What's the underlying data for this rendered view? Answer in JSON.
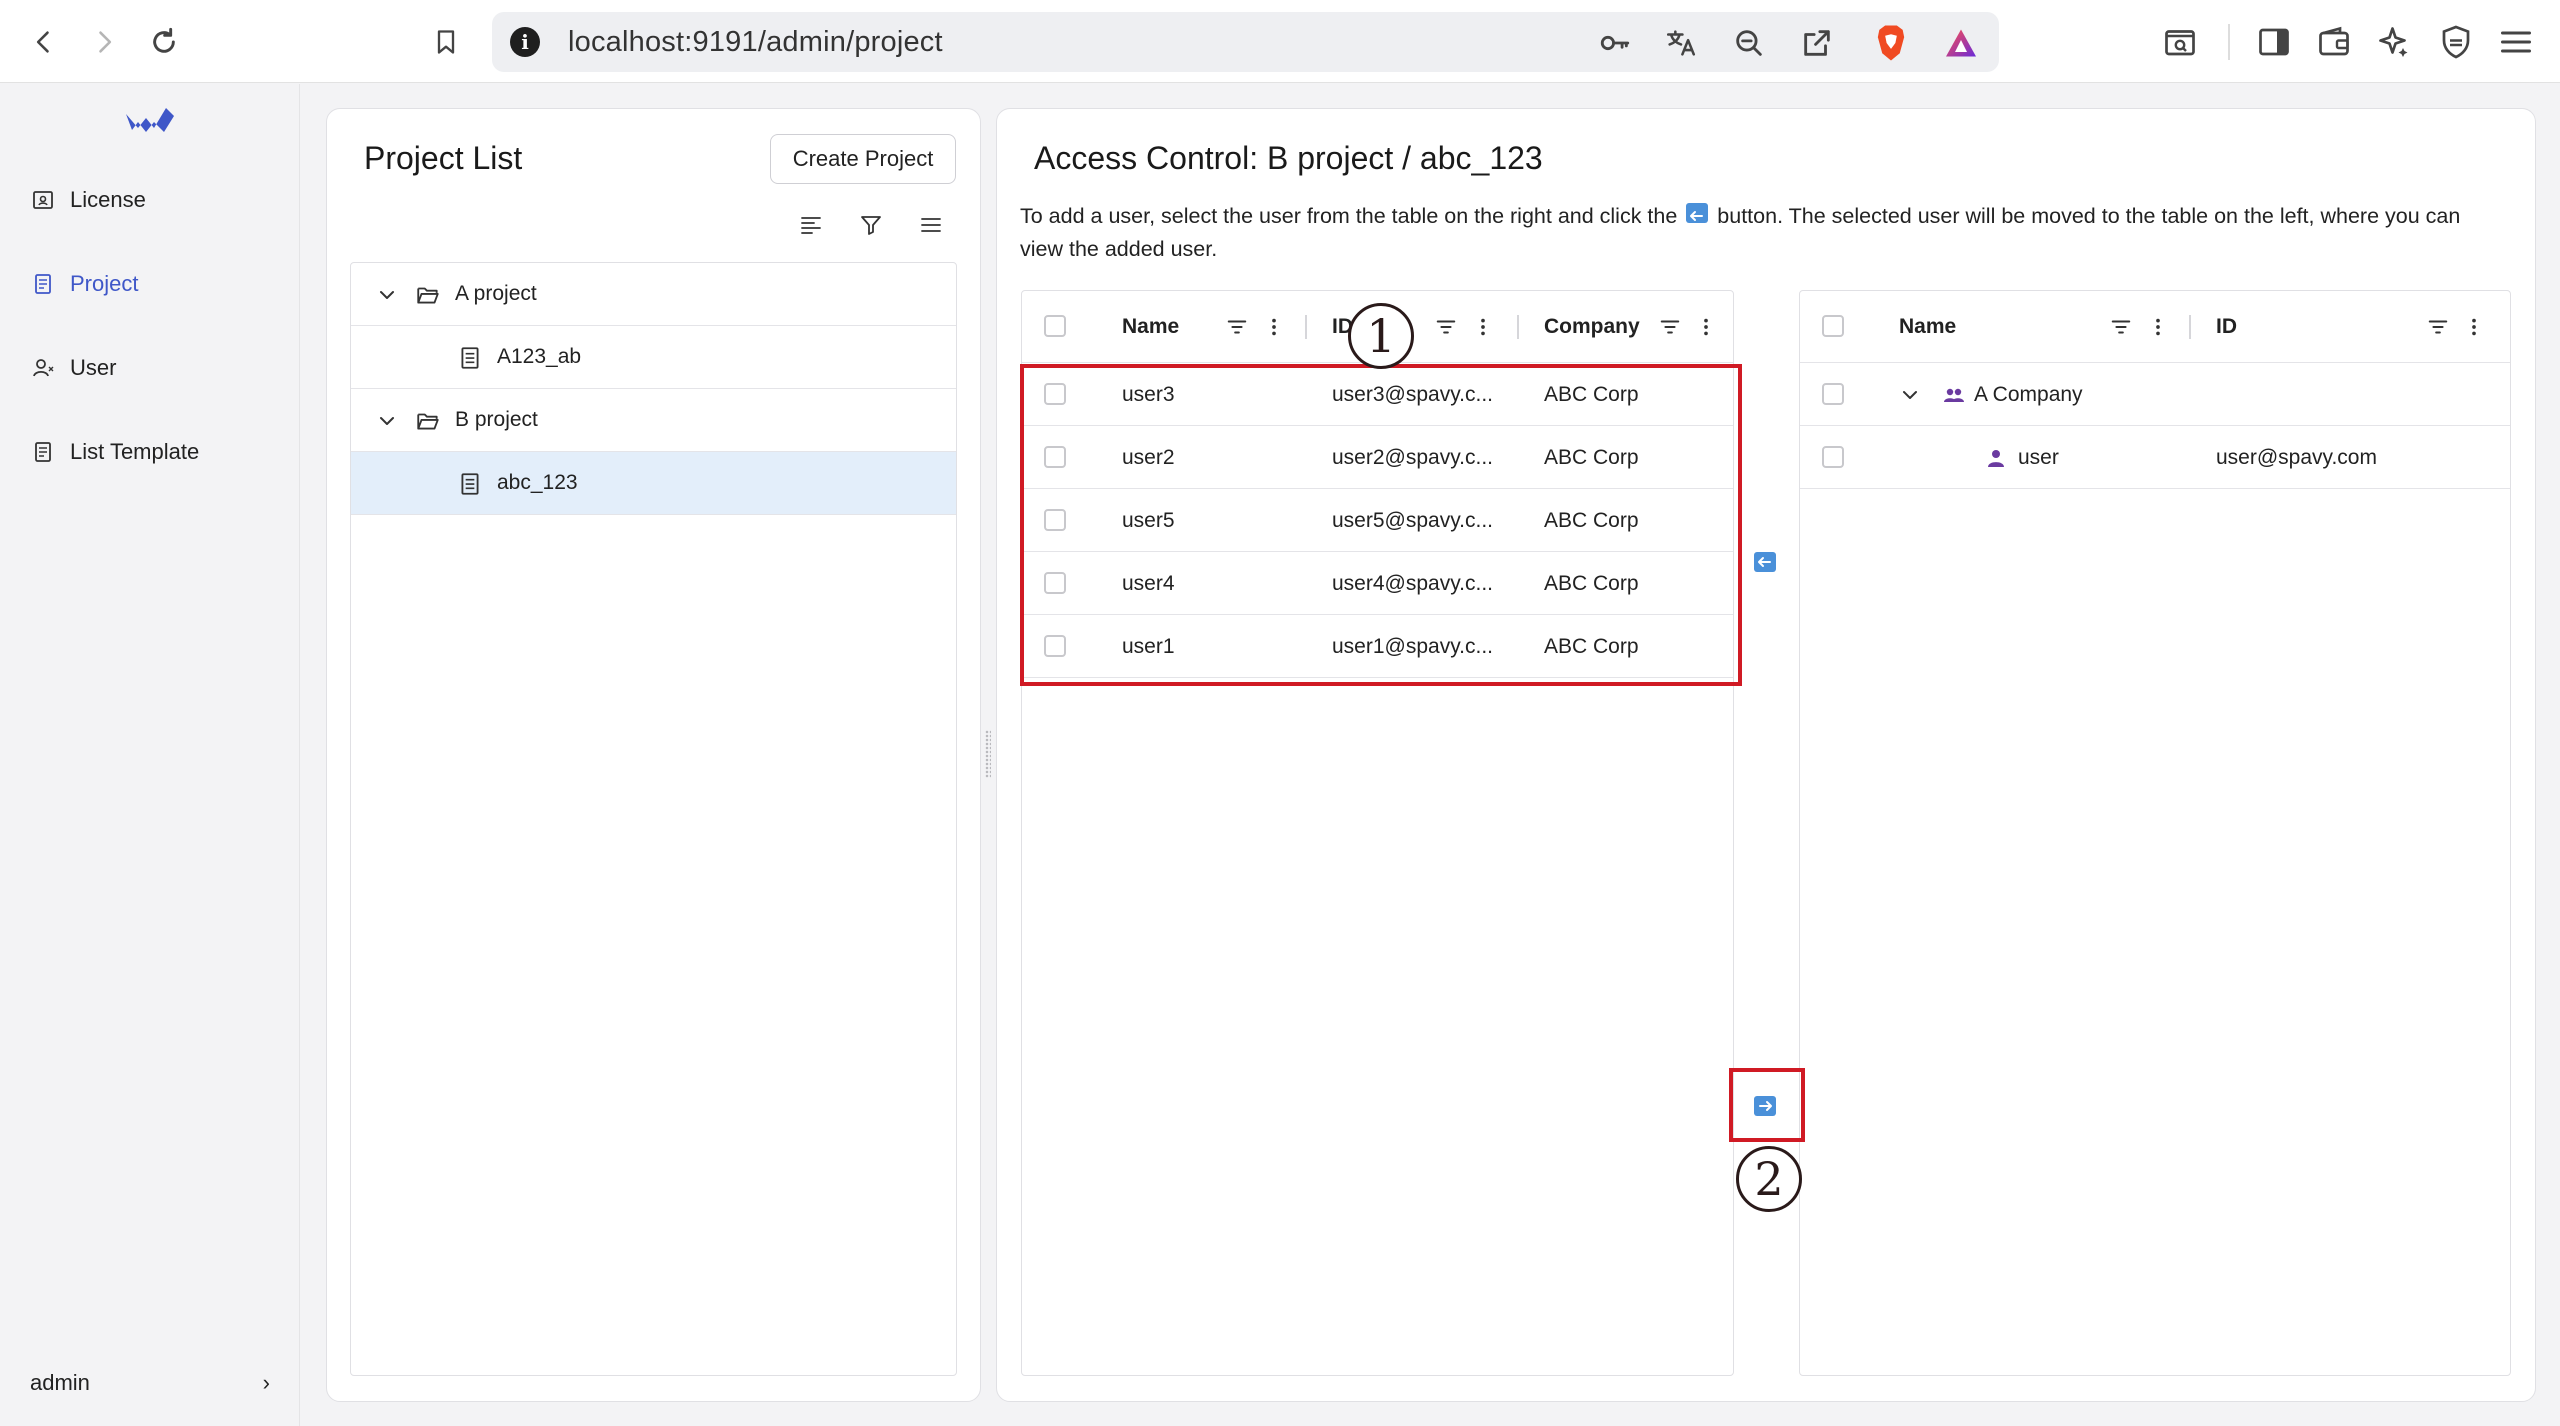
{
  "browser": {
    "url": "localhost:9191/admin/project",
    "icons": [
      "back-icon",
      "forward-icon",
      "reload-icon",
      "bookmark-icon",
      "info-icon",
      "key-icon",
      "translate-icon",
      "zoom-out-icon",
      "share-icon",
      "brave-shield-icon",
      "brave-rewards-icon",
      "screenshot-icon",
      "sidebar-icon",
      "wallet-icon",
      "leo-ai-icon",
      "vpn-icon",
      "menu-icon"
    ]
  },
  "sidebar": {
    "items": [
      {
        "label": "License",
        "icon": "license-icon",
        "active": false
      },
      {
        "label": "Project",
        "icon": "project-icon",
        "active": true
      },
      {
        "label": "User",
        "icon": "user-icon",
        "active": false
      },
      {
        "label": "List Template",
        "icon": "list-template-icon",
        "active": false
      }
    ],
    "user_label": "admin",
    "user_chevron": "›"
  },
  "project_list": {
    "title": "Project List",
    "create_label": "Create Project",
    "tree": [
      {
        "label": "A project",
        "type": "folder"
      },
      {
        "label": "A123_ab",
        "type": "item"
      },
      {
        "label": "B project",
        "type": "folder"
      },
      {
        "label": "abc_123",
        "type": "item",
        "selected": true
      }
    ]
  },
  "access_control": {
    "title": "Access Control: B project / abc_123",
    "desc_before": "To add a user, select the user from the table on the right and click the",
    "desc_after": "button. The selected user will be moved to the table on the left, where you can view the added user.",
    "left_table": {
      "headers": [
        "Name",
        "ID",
        "Company"
      ],
      "rows": [
        {
          "name": "user3",
          "id": "user3@spavy.c...",
          "company": "ABC Corp"
        },
        {
          "name": "user2",
          "id": "user2@spavy.c...",
          "company": "ABC Corp"
        },
        {
          "name": "user5",
          "id": "user5@spavy.c...",
          "company": "ABC Corp"
        },
        {
          "name": "user4",
          "id": "user4@spavy.c...",
          "company": "ABC Corp"
        },
        {
          "name": "user1",
          "id": "user1@spavy.c...",
          "company": "ABC Corp"
        }
      ]
    },
    "right_table": {
      "headers": [
        "Name",
        "ID"
      ],
      "group": {
        "name": "A Company"
      },
      "rows": [
        {
          "name": "user",
          "id": "user@spavy.com"
        }
      ]
    }
  },
  "annotations": {
    "one": "1",
    "two": "2"
  },
  "colors": {
    "accent": "#3f57c8",
    "selected_row": "#e3eefa",
    "transfer_button": "#4a90d9",
    "annotation_red": "#d01a24",
    "user_icon_purple": "#6a3aa0"
  }
}
